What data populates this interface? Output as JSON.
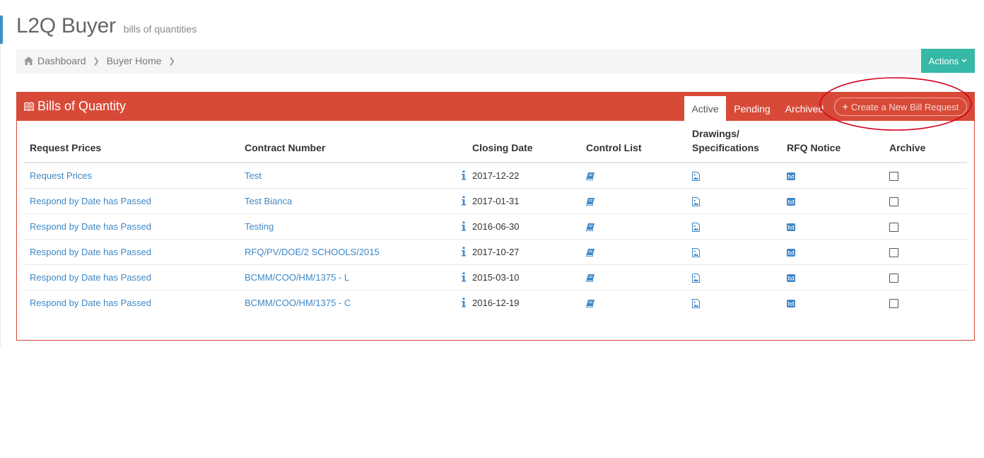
{
  "header": {
    "title": "L2Q Buyer",
    "subtitle": "bills of quantities"
  },
  "breadcrumb": {
    "items": [
      "Dashboard",
      "Buyer Home"
    ],
    "home_icon": "home-icon"
  },
  "actions": {
    "label": "Actions"
  },
  "portlet": {
    "title": "Bills of Quantity",
    "title_icon": "book-icon",
    "tabs": [
      {
        "label": "Active",
        "active": true
      },
      {
        "label": "Pending",
        "active": false
      },
      {
        "label": "Archived",
        "active": false
      }
    ],
    "create_button": "Create a New Bill Request"
  },
  "table": {
    "columns": {
      "request_prices": "Request Prices",
      "contract_number": "Contract Number",
      "closing_date": "Closing Date",
      "control_list": "Control List",
      "drawings_line1": "Drawings/",
      "drawings_line2": "Specifications",
      "rfq_notice": "RFQ Notice",
      "archive": "Archive"
    },
    "rows": [
      {
        "request": "Request Prices",
        "contract": "Test",
        "closing": "2017-12-22",
        "archived": false
      },
      {
        "request": "Respond by Date has Passed",
        "contract": "Test Bianca",
        "closing": "2017-01-31",
        "archived": false
      },
      {
        "request": "Respond by Date has Passed",
        "contract": "Testing",
        "closing": "2016-06-30",
        "archived": false
      },
      {
        "request": "Respond by Date has Passed",
        "contract": "RFQ/PV/DOE/2 SCHOOLS/2015",
        "closing": "2017-10-27",
        "archived": false
      },
      {
        "request": "Respond by Date has Passed",
        "contract": "BCMM/COO/HM/1375 - L",
        "closing": "2015-03-10",
        "archived": false
      },
      {
        "request": "Respond by Date has Passed",
        "contract": "BCMM/COO/HM/1375 - C",
        "closing": "2016-12-19",
        "archived": false
      }
    ],
    "icons": {
      "info": "info-icon",
      "control_list": "book-icon",
      "drawings": "image-file-icon",
      "rfq": "envelope-icon"
    }
  },
  "colors": {
    "portlet_red": "#d84a38",
    "link_blue": "#3f87c6",
    "actions_teal": "#36b9a7",
    "annotation_red": "#d0021b"
  }
}
